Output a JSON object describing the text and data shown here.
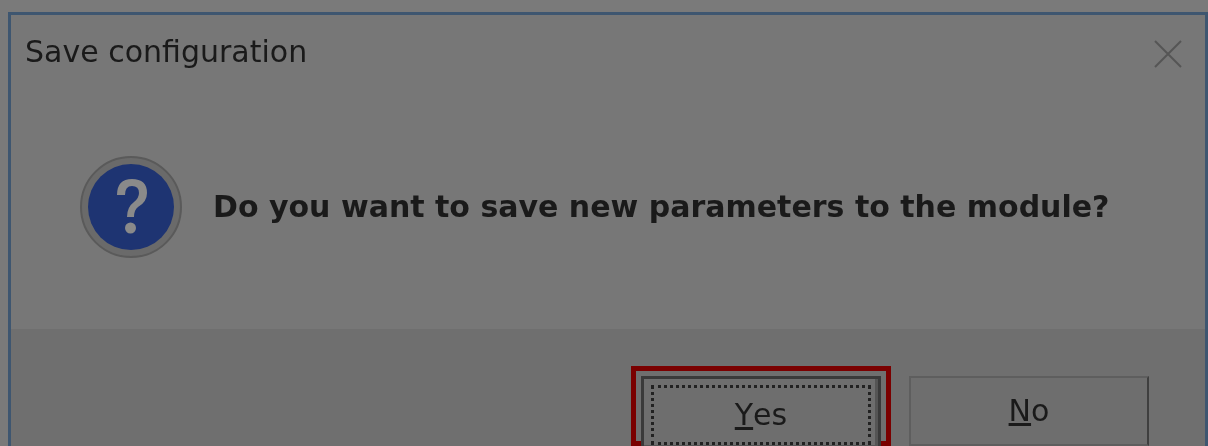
{
  "window": {
    "title": "Save configuration"
  },
  "message": {
    "text": "Do you want to save new parameters to the module?"
  },
  "buttons": [
    {
      "label": "Yes",
      "underline_first": true,
      "focused": true,
      "highlighted": true
    },
    {
      "label": "No",
      "underline_first": true,
      "focused": false,
      "highlighted": false
    }
  ]
}
